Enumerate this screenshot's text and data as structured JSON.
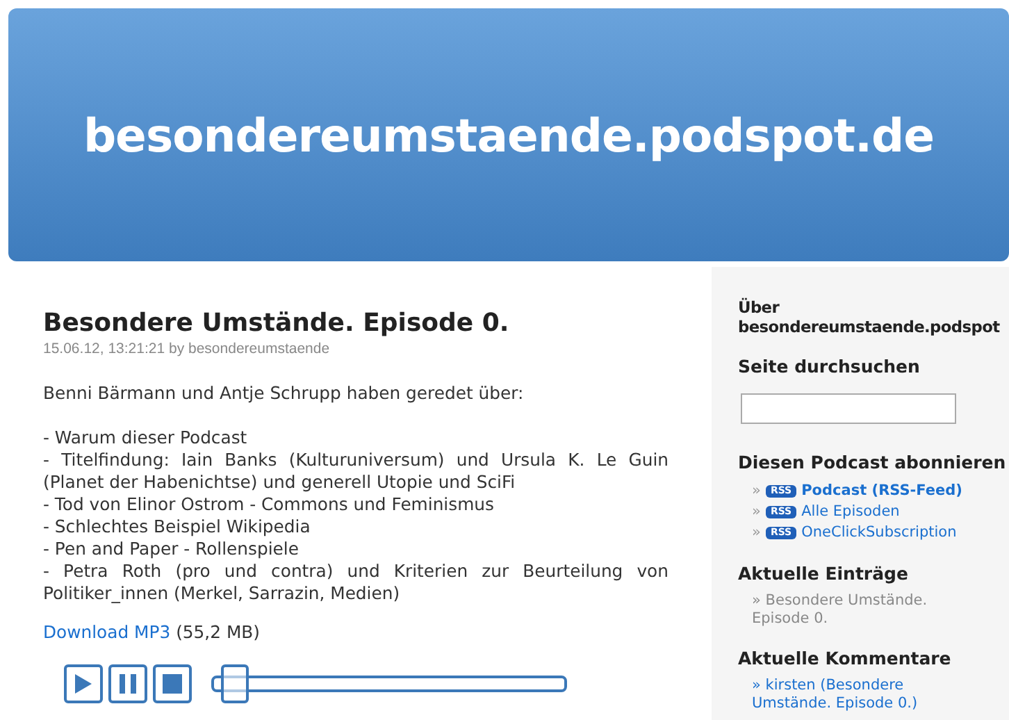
{
  "site_title": "besondereumstaende.podspot.de",
  "post": {
    "title": "Besondere Umstände. Episode 0.",
    "meta": "15.06.12, 13:21:21 by besondereumstaende",
    "intro": "Benni Bärmann und Antje Schrupp haben geredet über:",
    "topics": [
      "- Warum dieser Podcast",
      "- Titelfindung: Iain Banks (Kulturuniversum) und Ursula K. Le Guin (Planet der Habenichtse) und generell Utopie und SciFi",
      "- Tod von Elinor Ostrom - Commons und Feminismus",
      "- Schlechtes Beispiel Wikipedia",
      "- Pen and Paper - Rollenspiele",
      "- Petra Roth (pro und contra) und Kriterien zur Beurteilung von Politiker_innen (Merkel, Sarrazin, Medien)"
    ],
    "download": {
      "link": "Download MP3",
      "size": "(55,2 MB)"
    },
    "player": {
      "level": 0.03
    }
  },
  "sidebar": [
    {
      "kind": "heading",
      "title": "Über besondereumstaende.podspot"
    },
    {
      "kind": "search",
      "title": "Seite durchsuchen"
    },
    {
      "kind": "feeds",
      "title": "Diesen Podcast abonnieren",
      "items": [
        {
          "bullet": "»",
          "badge": "RSS",
          "label": "Podcast (RSS-Feed)",
          "bold": true
        },
        {
          "bullet": "»",
          "badge": "RSS",
          "label": "Alle Episoden",
          "bold": false
        },
        {
          "bullet": "»",
          "badge": "RSS",
          "label": "OneClickSubscription",
          "bold": false
        }
      ]
    },
    {
      "kind": "entries",
      "title": "Aktuelle Einträge",
      "items": [
        {
          "bullet": "»",
          "label": "Besondere Umstände. Episode 0."
        }
      ]
    },
    {
      "kind": "comments",
      "title": "Aktuelle Kommentare",
      "items": [
        {
          "bullet": "»",
          "label": "kirsten (Besondere Umstände. Episode 0.)"
        }
      ]
    }
  ]
}
